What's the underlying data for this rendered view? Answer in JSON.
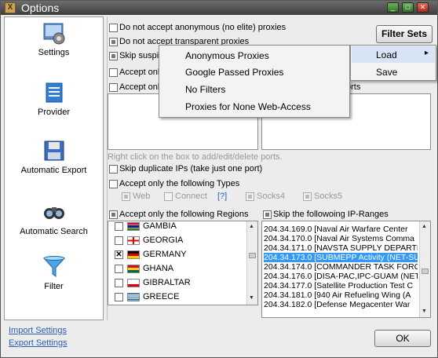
{
  "window": {
    "title": "Options",
    "app_icon_glyph": "X",
    "minimize": "_",
    "maximize": "□",
    "close": "✕"
  },
  "sidebar": {
    "items": [
      {
        "label": "Settings",
        "icon": "settings-icon"
      },
      {
        "label": "Provider",
        "icon": "provider-icon"
      },
      {
        "label": "Automatic Export",
        "icon": "floppy-disk-icon"
      },
      {
        "label": "Automatic Search",
        "icon": "binoculars-icon"
      },
      {
        "label": "Filter",
        "icon": "funnel-icon"
      }
    ]
  },
  "filters": {
    "opt1": "Do not accept anonymous (no elite) proxies",
    "opt2": "Do not accept transparent proxies",
    "opt3": "Skip suspic",
    "opt4": "Accept onl",
    "opt5": "Accept onl",
    "ports_right_label": "orts",
    "hint": "Right click on the box to add/edit/delete ports.",
    "skip_dup": "Skip duplicate IPs (take just one port)",
    "types_label": "Accept only the following Types",
    "types": {
      "web": "Web",
      "connect": "Connect",
      "help": "[?]",
      "socks4": "Socks4",
      "socks5": "Socks5"
    },
    "regions_label": "Accept only the following Regions",
    "ipranges_label": "Skip the followoing IP-Ranges"
  },
  "regions": [
    {
      "name": "GAMBIA",
      "checked": false
    },
    {
      "name": "GEORGIA",
      "checked": false
    },
    {
      "name": "GERMANY",
      "checked": true,
      "mark": "✕"
    },
    {
      "name": "GHANA",
      "checked": false
    },
    {
      "name": "GIBRALTAR",
      "checked": false
    },
    {
      "name": "GREECE",
      "checked": false
    }
  ],
  "ipranges": [
    "204.34.169.0 [Naval Air Warfare Center",
    "204.34.170.0 [Naval Air Systems Comma",
    "204.34.171.0 [NAVSTA SUPPLY DEPARTM",
    "204.34.173.0 [SUBMEPP Activity (NET-SU",
    "204.34.174.0 [COMMANDER TASK FORC",
    "204.34.176.0 [DISA-PAC,IPC-GUAM (NET",
    "204.34.177.0 [Satellite Production Test C",
    "204.34.181.0 [940 Air Refueling Wing (A",
    "204.34.182.0 [Defense Megacenter War"
  ],
  "selected_ip_index": 3,
  "filter_sets_button": "Filter Sets",
  "context_menu": {
    "items": [
      "Anonymous Proxies",
      "Google Passed Proxies",
      "No Filters",
      "Proxies for None Web-Access"
    ]
  },
  "submenu": {
    "load": "Load",
    "save": "Save",
    "arrow": "▸"
  },
  "footer": {
    "import": "Import Settings",
    "export": "Export Settings",
    "ok": "OK"
  },
  "colors": {
    "selection": "#3399ff",
    "link": "#2a5db0"
  }
}
